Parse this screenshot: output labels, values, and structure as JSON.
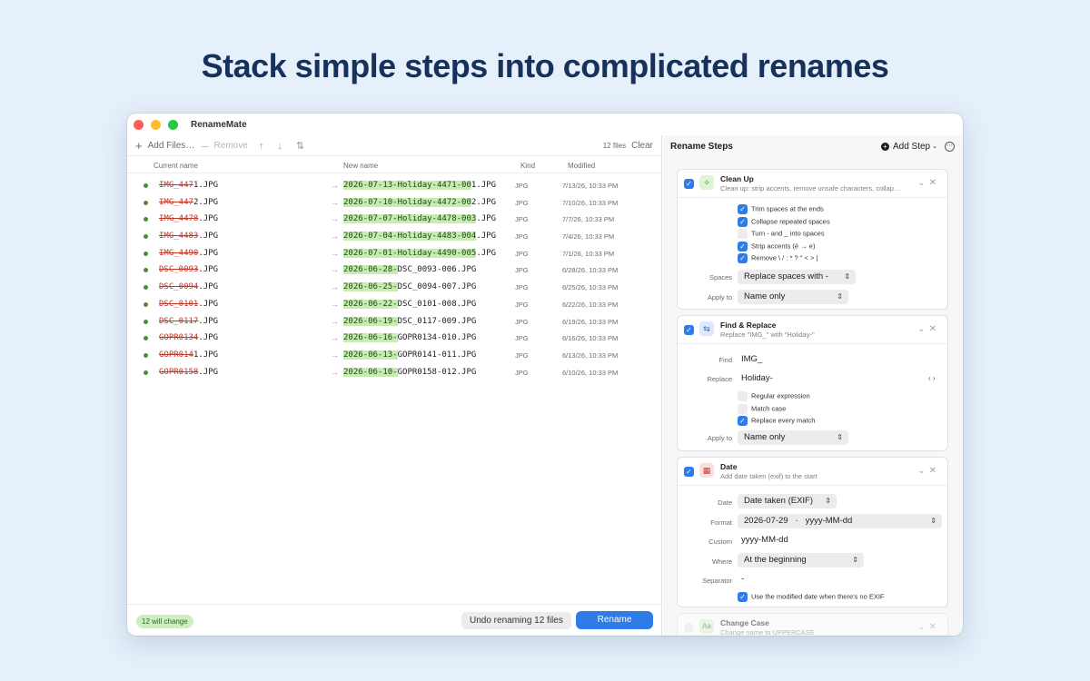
{
  "headline": "Stack simple steps into complicated renames",
  "window": {
    "title": "RenameMate"
  },
  "toolbar": {
    "add_files": "Add Files…",
    "remove": "Remove",
    "move_arrows": "↑ ↓ ⇅",
    "file_count": "12 files",
    "clear": "Clear"
  },
  "columns": {
    "current": "Current name",
    "new": "New name",
    "kind": "Kind",
    "modified": "Modified"
  },
  "files": [
    {
      "old": "IMG_447",
      "keep": "1.JPG",
      "new_pre": "",
      "new_hl": "2026-07-13-Holiday-4471-00",
      "new_post": "1.JPG",
      "kind": "JPG",
      "modified": "7/13/26, 10:33 PM"
    },
    {
      "old": "IMG_447",
      "keep": "2.JPG",
      "new_pre": "",
      "new_hl": "2026-07-10-Holiday-4472-00",
      "new_post": "2.JPG",
      "kind": "JPG",
      "modified": "7/10/26, 10:33 PM"
    },
    {
      "old": "IMG_4478",
      "keep": ".JPG",
      "new_pre": "",
      "new_hl": "2026-07-07-Holiday-4478-003",
      "new_post": ".JPG",
      "kind": "JPG",
      "modified": "7/7/26, 10:33 PM"
    },
    {
      "old": "IMG_4483",
      "keep": ".JPG",
      "new_pre": "",
      "new_hl": "2026-07-04-Holiday-4483-004",
      "new_post": ".JPG",
      "kind": "JPG",
      "modified": "7/4/26, 10:33 PM"
    },
    {
      "old": "IMG_4490",
      "keep": ".JPG",
      "new_pre": "",
      "new_hl": "2026-07-01-Holiday-4490-005",
      "new_post": ".JPG",
      "kind": "JPG",
      "modified": "7/1/26, 10:33 PM"
    },
    {
      "old": "DSC_0093",
      "keep": ".JPG",
      "new_pre": "",
      "new_hl": "2026-06-28-",
      "new_post": "DSC_0093-006.JPG",
      "kind": "JPG",
      "modified": "6/28/26, 10:33 PM"
    },
    {
      "old": "DSC_0094",
      "keep": ".JPG",
      "new_pre": "",
      "new_hl": "2026-06-25-",
      "new_post": "DSC_0094-007.JPG",
      "kind": "JPG",
      "modified": "6/25/26, 10:33 PM"
    },
    {
      "old": "DSC_0101",
      "keep": ".JPG",
      "new_pre": "",
      "new_hl": "2026-06-22-",
      "new_post": "DSC_0101-008.JPG",
      "kind": "JPG",
      "modified": "6/22/26, 10:33 PM"
    },
    {
      "old": "DSC_0117",
      "keep": ".JPG",
      "new_pre": "",
      "new_hl": "2026-06-19-",
      "new_post": "DSC_0117-009.JPG",
      "kind": "JPG",
      "modified": "6/19/26, 10:33 PM"
    },
    {
      "old": "GOPR0134",
      "keep": ".JPG",
      "new_pre": "",
      "new_hl": "2026-06-16-",
      "new_post": "GOPR0134-010.JPG",
      "kind": "JPG",
      "modified": "6/16/26, 10:33 PM"
    },
    {
      "old": "GOPR014",
      "keep": "1.JPG",
      "new_pre": "",
      "new_hl": "2026-06-13-",
      "new_post": "GOPR0141-011.JPG",
      "kind": "JPG",
      "modified": "6/13/26, 10:33 PM"
    },
    {
      "old": "GOPR0158",
      "keep": ".JPG",
      "new_pre": "",
      "new_hl": "2026-06-10-",
      "new_post": "GOPR0158-012.JPG",
      "kind": "JPG",
      "modified": "6/10/26, 10:33 PM"
    }
  ],
  "footer": {
    "badge": "12 will change",
    "undo": "Undo renaming 12 files",
    "rename": "Rename"
  },
  "steps_panel": {
    "title": "Rename Steps",
    "add_step": "Add Step",
    "more": "⋯"
  },
  "cleanup": {
    "name": "Clean Up",
    "desc": "Clean up: strip accents, remove unsafe characters, collap…",
    "options": [
      {
        "label": "Trim spaces at the ends",
        "checked": true
      },
      {
        "label": "Collapse repeated spaces",
        "checked": true
      },
      {
        "label": "Turn - and _ into spaces",
        "checked": false
      },
      {
        "label": "Strip accents (é → e)",
        "checked": true
      },
      {
        "label": "Remove \\ / : * ? \" < > |",
        "checked": true
      }
    ],
    "spaces_label": "Spaces",
    "spaces_value": "Replace spaces with -",
    "apply_label": "Apply to",
    "apply_value": "Name only"
  },
  "find_replace": {
    "name": "Find & Replace",
    "desc": "Replace \"IMG_\" with \"Holiday-\"",
    "find_label": "Find",
    "find_value": "IMG_",
    "replace_label": "Replace",
    "replace_value": "Holiday-",
    "token_icon": "‹ ›",
    "options": [
      {
        "label": "Regular expression",
        "checked": false
      },
      {
        "label": "Match case",
        "checked": false
      },
      {
        "label": "Replace every match",
        "checked": true
      }
    ],
    "apply_label": "Apply to",
    "apply_value": "Name only"
  },
  "date": {
    "name": "Date",
    "desc": "Add date taken (exif) to the start",
    "date_label": "Date",
    "date_value": "Date taken (EXIF)",
    "format_label": "Format",
    "format_value": "2026-07-29   ·   yyyy-MM-dd",
    "custom_label": "Custom",
    "custom_value": "yyyy-MM-dd",
    "where_label": "Where",
    "where_value": "At the beginning",
    "sep_label": "Separator",
    "sep_value": "-",
    "fallback": "Use the modified date when there's no EXIF"
  },
  "change_case": {
    "name": "Change Case",
    "desc": "Change name to UPPERCASE",
    "icon_text": "Aa"
  }
}
